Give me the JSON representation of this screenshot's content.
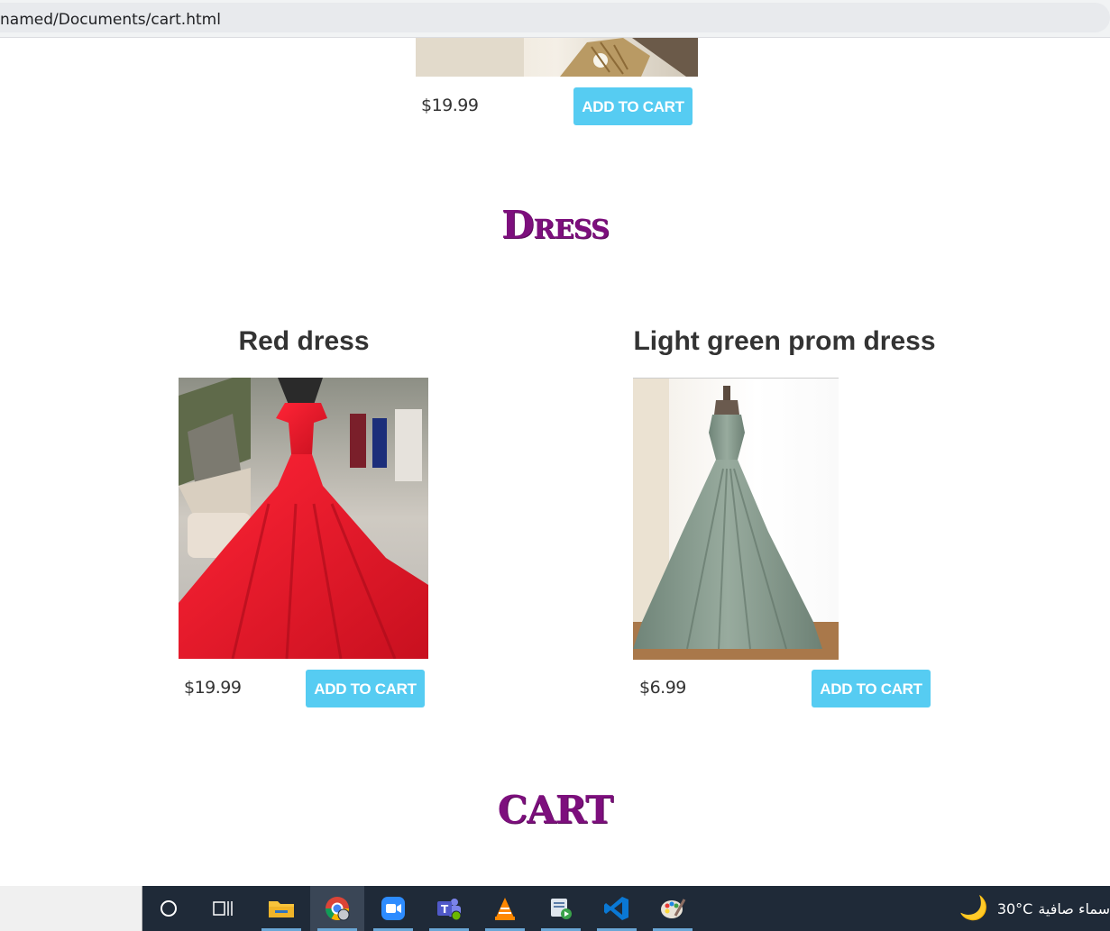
{
  "browser": {
    "url": "named/Documents/cart.html"
  },
  "top_product": {
    "price": "$19.99",
    "button": "ADD TO CART"
  },
  "sections": {
    "dress_title": "Dress",
    "cart_title": "CART"
  },
  "dresses": [
    {
      "title": "Red dress",
      "price": "$19.99",
      "button": "ADD TO CART"
    },
    {
      "title": "Light green prom dress",
      "price": "$6.99",
      "button": "ADD TO CART"
    }
  ],
  "taskbar": {
    "icons": [
      "cortana-icon",
      "task-view-icon",
      "file-explorer-icon",
      "chrome-icon",
      "zoom-icon",
      "teams-icon",
      "vlc-icon",
      "media-icon",
      "vscode-icon",
      "paint-icon"
    ],
    "weather_temp": "30°C",
    "weather_text": "سماء صافية"
  },
  "colors": {
    "accent": "#56ccf2",
    "section_title": "#7d0f7d",
    "taskbar": "#1f2a38"
  }
}
